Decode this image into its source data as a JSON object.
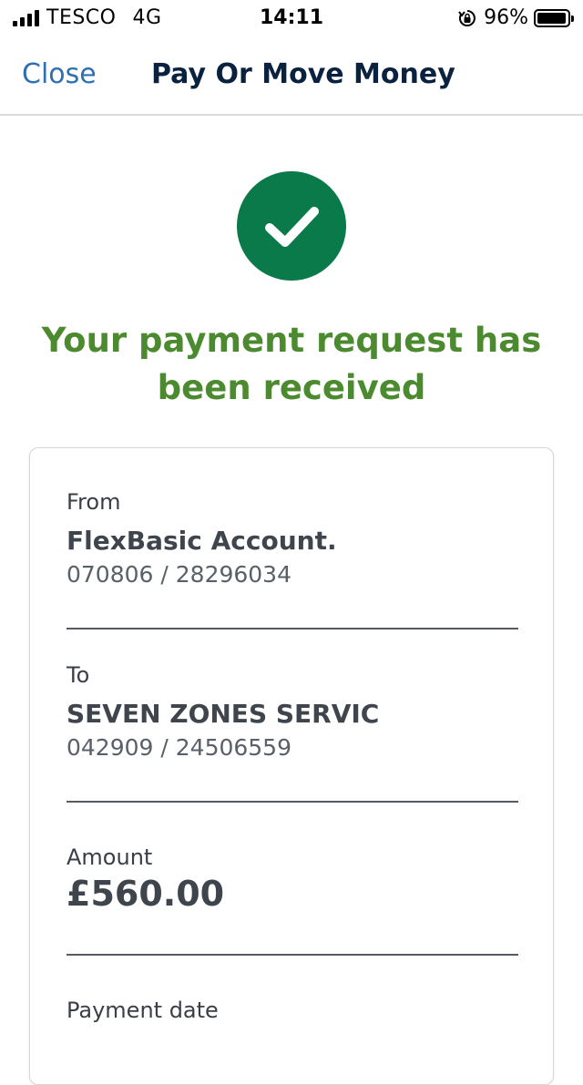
{
  "status_bar": {
    "carrier": "TESCO",
    "network": "4G",
    "time": "14:11",
    "battery_percent": "96%",
    "battery_level": 0.96
  },
  "nav": {
    "close_label": "Close",
    "title": "Pay Or Move Money"
  },
  "confirmation": {
    "icon": "checkmark-icon",
    "message": "Your payment request has been received",
    "accent_color": "#0b7a4b",
    "message_color": "#4c8a2f"
  },
  "details": {
    "from": {
      "label": "From",
      "account_name": "FlexBasic Account.",
      "account_number": "070806 / 28296034"
    },
    "to": {
      "label": "To",
      "payee_name": "SEVEN ZONES SERVIC",
      "account_number": "042909 / 24506559"
    },
    "amount": {
      "label": "Amount",
      "value": "£560.00"
    },
    "payment_date": {
      "label": "Payment date"
    }
  }
}
